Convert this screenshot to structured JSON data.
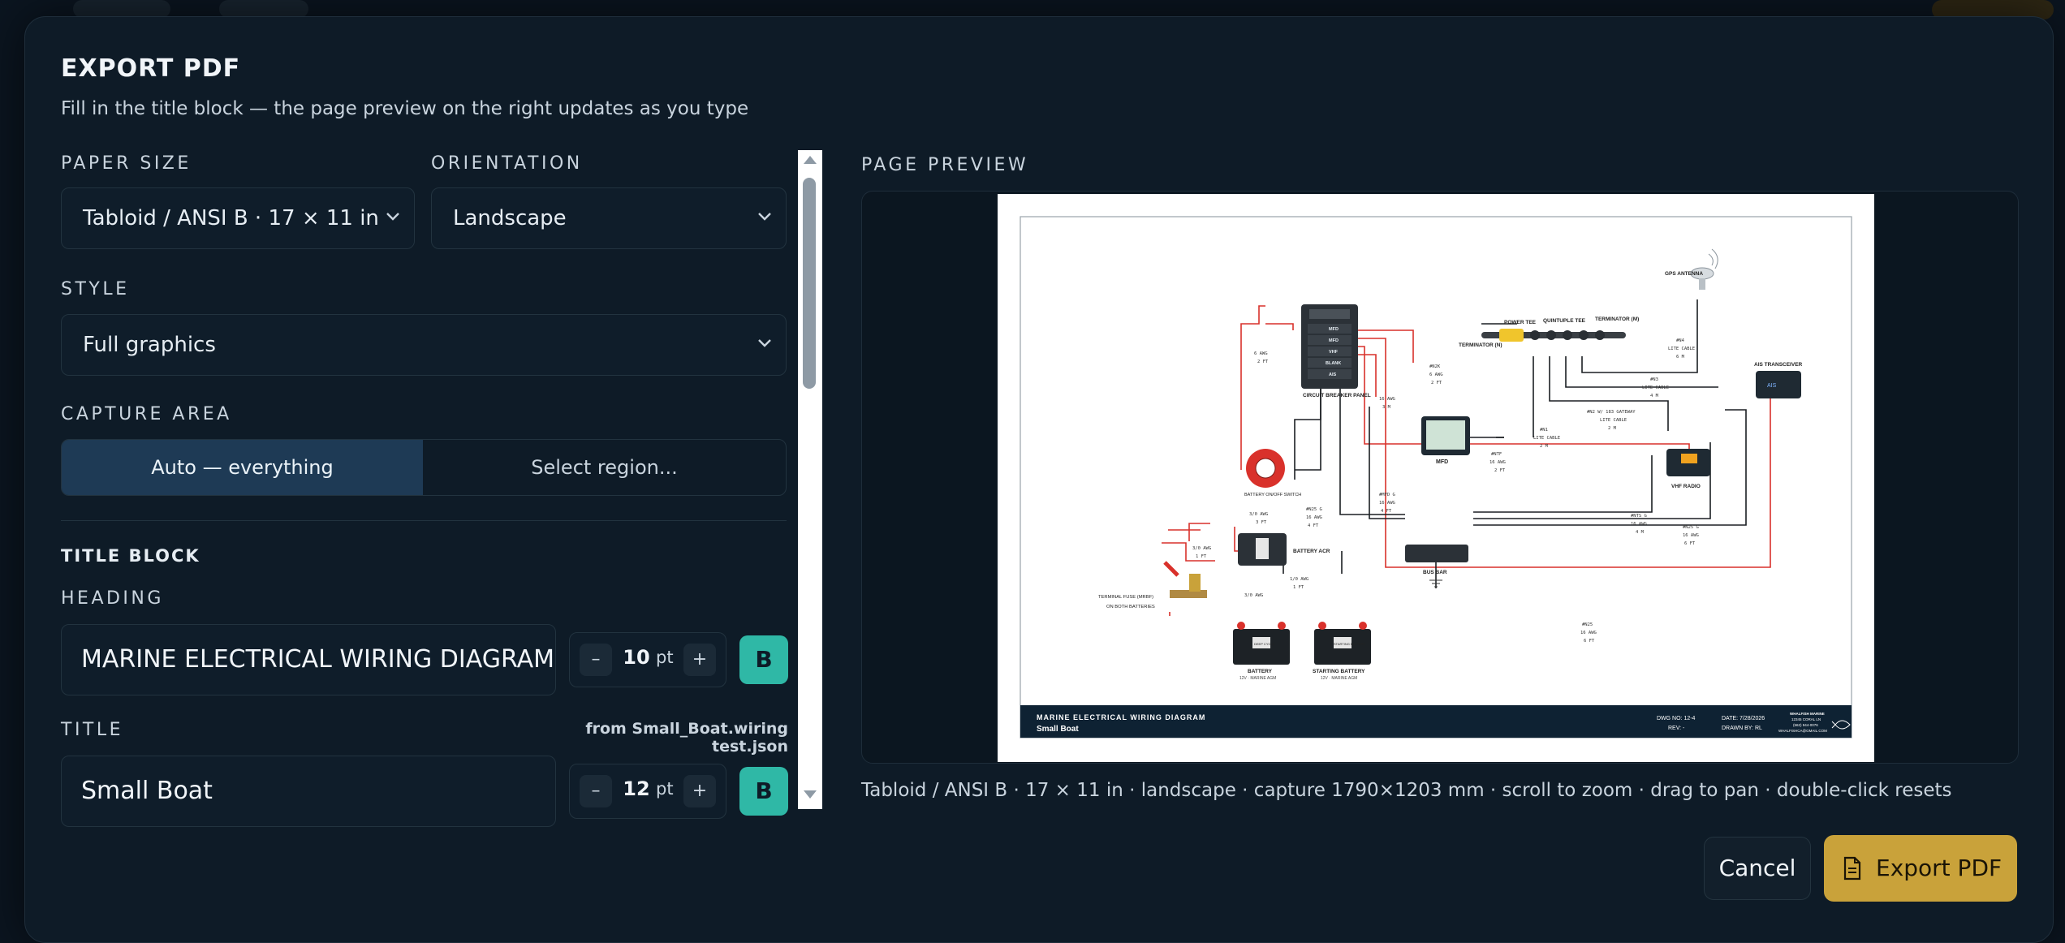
{
  "dialog": {
    "title": "EXPORT PDF",
    "subtitle": "Fill in the title block — the page preview on the right updates as you type"
  },
  "paper_size": {
    "label": "PAPER SIZE",
    "value": "Tabloid / ANSI B · 17 × 11 in",
    "icon": "chevron-down-icon"
  },
  "orientation": {
    "label": "ORIENTATION",
    "value": "Landscape",
    "icon": "chevron-down-icon"
  },
  "style": {
    "label": "STYLE",
    "value": "Full graphics",
    "icon": "chevron-down-icon"
  },
  "capture_area": {
    "label": "CAPTURE AREA",
    "options": [
      "Auto — everything",
      "Select region..."
    ],
    "selected": "Auto — everything"
  },
  "title_block": {
    "section_label": "TITLE BLOCK",
    "heading": {
      "label": "HEADING",
      "value": "MARINE ELECTRICAL WIRING DIAGRAM",
      "size": "10",
      "unit": "pt",
      "minus": "–",
      "plus": "+",
      "bold_label": "B"
    },
    "title": {
      "label": "TITLE",
      "source": "from Small_Boat.wiring test.json",
      "value": "Small Boat",
      "size": "12",
      "unit": "pt",
      "minus": "–",
      "plus": "+",
      "bold_label": "B"
    }
  },
  "preview": {
    "label": "PAGE PREVIEW",
    "caption": "Tabloid / ANSI B · 17 × 11 in · landscape · capture 1790×1203 mm · scroll to zoom · drag to pan · double-click resets",
    "sheet": {
      "components": {
        "gps": "GPS ANTENNA",
        "power_tee": "POWER TEE",
        "quintuple_tee": "QUINTUPLE TEE",
        "terminator_m": "TERMINATOR (M)",
        "terminator_n": "TERMINATOR (N)",
        "ais": "AIS TRANSCEIVER",
        "breaker_panel": "CIRCUIT BREAKER PANEL",
        "mfd": "MFD",
        "vhf": "VHF RADIO",
        "battery_switch": "BATTERY ON/OFF SWITCH",
        "battery_acr": "BATTERY ACR",
        "bus_bar": "BUS BAR",
        "fuse": "TERMINAL FUSE (MRBF)",
        "fuse_note": "ON BOTH BATTERIES",
        "house_battery": "BATTERY",
        "starting_battery": "STARTING BATTERY",
        "battery_spec": "12V · MARINE AGM",
        "deep_cycle": "DEEP CYCLE",
        "starting_label": "STARTING BATTERY"
      },
      "breakers": [
        "MFD",
        "MFD",
        "VHF",
        "BLANK",
        "AIS"
      ],
      "wires": {
        "w1": "6 AWG",
        "w1b": "2 FT",
        "w2": "#N2K",
        "w2b": "6 AWG",
        "w2c": "2 FT",
        "w3": "#N4",
        "w3b": "LITE CABLE",
        "w3c": "6 M",
        "w4": "#N3",
        "w4b": "LITE CABLE",
        "w4c": "4 M",
        "w5": "#N2 W/ 183 GATEWAY",
        "w5b": "LITE CABLE",
        "w5c": "2 M",
        "w6": "#N1",
        "w6b": "LITE CABLE",
        "w6c": "2 M",
        "w7": "16 AWG",
        "w7b": "3 M",
        "w8": "#NTF",
        "w8b": "16 AWG",
        "w8c": "2 FT",
        "w9": "3/0 AWG",
        "w9b": "3 FT",
        "w10": "#N25 G",
        "w10b": "16 AWG",
        "w10c": "4 FT",
        "w11": "#MFD G",
        "w11b": "16 AWG",
        "w11c": "4 FT",
        "w12": "#NTS G",
        "w12b": "16 AWG",
        "w12c": "4 M",
        "w13": "#N25 G",
        "w13b": "16 AWG",
        "w13c": "6 FT",
        "w14": "3/0 AWG",
        "w14b": "1 FT",
        "w15": "1/0 AWG",
        "w15b": "1 FT",
        "w16": "3/0 AWG",
        "w17": "#N25",
        "w17b": "16 AWG",
        "w17c": "6 FT"
      },
      "footer": {
        "heading": "MARINE ELECTRICAL WIRING DIAGRAM",
        "title": "Small Boat",
        "dwg_no": "DWG NO: 12-4",
        "rev": "REV: -",
        "date": "DATE: 7/28/2026",
        "drawn_by": "DRAWN BY: RL",
        "company": "WHALFISH MARINE",
        "company_line2": "12345 CORAL LN",
        "phone": "(562) 944-0076",
        "email": "WHALFISHCA@GMAIL.COM"
      }
    }
  },
  "actions": {
    "cancel": "Cancel",
    "export": "Export PDF",
    "export_icon": "document-icon"
  },
  "colors": {
    "accent_teal": "#2fb8a6",
    "export_gold": "#c9a23a",
    "segment_active": "#1e3a55",
    "wire_red": "#d9312b",
    "title_bar": "#0e2233"
  }
}
